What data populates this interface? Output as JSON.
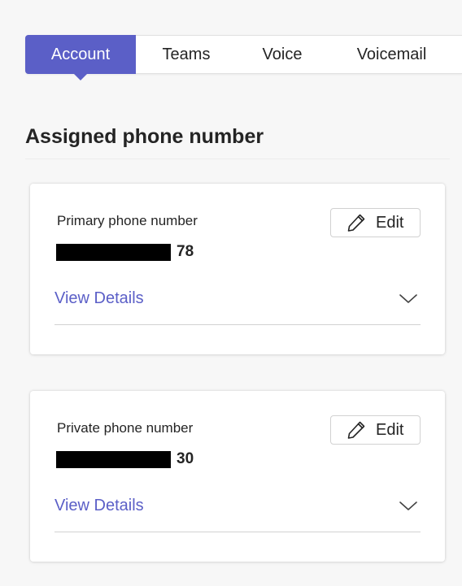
{
  "tabs": [
    {
      "label": "Account",
      "active": true
    },
    {
      "label": "Teams",
      "active": false
    },
    {
      "label": "Voice",
      "active": false
    },
    {
      "label": "Voicemail",
      "active": false
    }
  ],
  "section": {
    "title": "Assigned phone number"
  },
  "cards": [
    {
      "label": "Primary phone number",
      "number_suffix": "78",
      "edit_label": "Edit",
      "details_label": "View Details"
    },
    {
      "label": "Private phone number",
      "number_suffix": "30",
      "edit_label": "Edit",
      "details_label": "View Details"
    }
  ],
  "colors": {
    "accent": "#5b5fc7",
    "text": "#242424",
    "background": "#f7f7f7",
    "card": "#ffffff",
    "redaction": "#000000"
  },
  "icons": {
    "edit": "pencil-icon",
    "expand": "chevron-down-icon"
  }
}
